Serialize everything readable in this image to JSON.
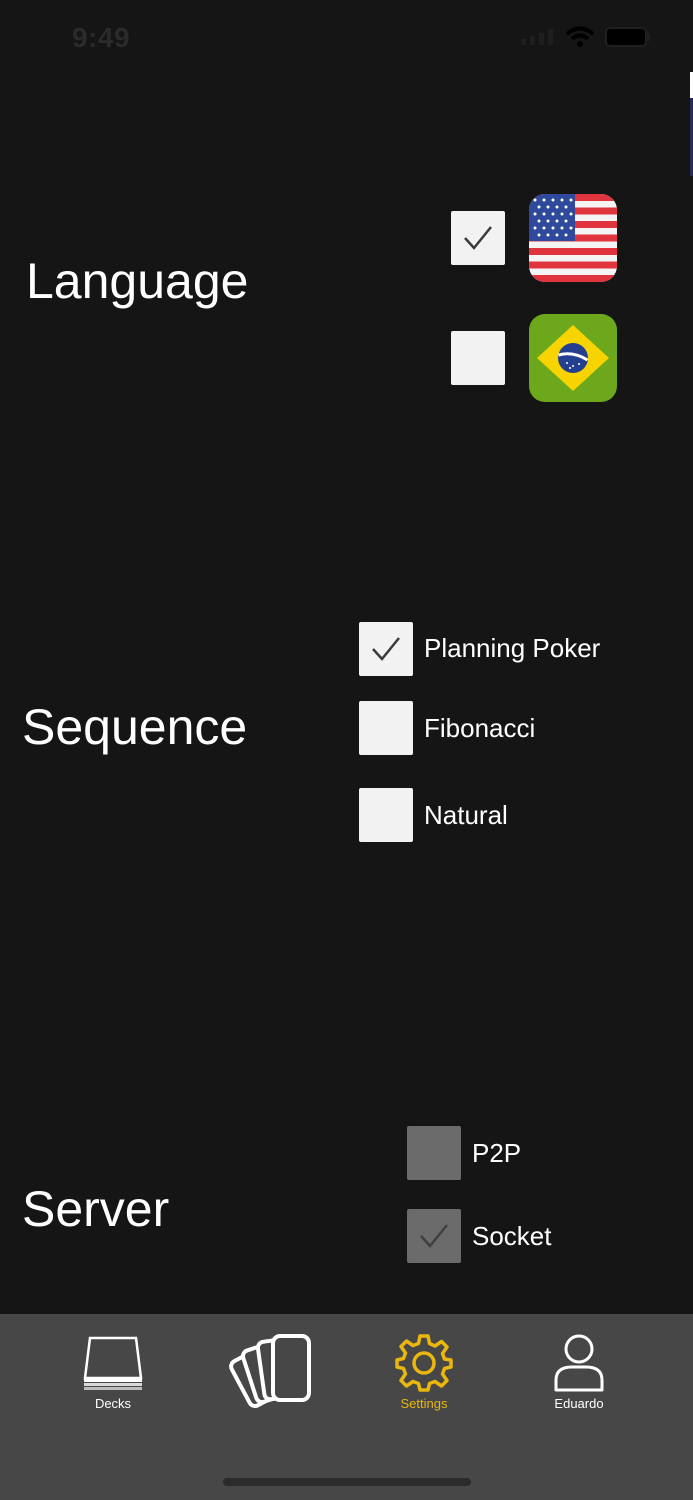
{
  "status_bar": {
    "time": "9:49"
  },
  "language": {
    "title": "Language",
    "options": [
      {
        "name": "English (US)",
        "flag": "us-flag-icon",
        "checked": true
      },
      {
        "name": "Portuguese (BR)",
        "flag": "brazil-flag-icon",
        "checked": false
      }
    ]
  },
  "sequence": {
    "title": "Sequence",
    "options": [
      {
        "label": "Planning Poker",
        "checked": true
      },
      {
        "label": "Fibonacci",
        "checked": false
      },
      {
        "label": "Natural",
        "checked": false
      }
    ]
  },
  "server": {
    "title": "Server",
    "options": [
      {
        "label": "P2P",
        "checked": false
      },
      {
        "label": "Socket",
        "checked": true
      }
    ]
  },
  "tab_bar": {
    "tabs": [
      {
        "label": "Decks",
        "icon": "deck-icon",
        "active": false
      },
      {
        "label": "",
        "icon": "cards-icon",
        "active": false
      },
      {
        "label": "Settings",
        "icon": "gear-icon",
        "active": true
      },
      {
        "label": "Eduardo",
        "icon": "user-icon",
        "active": false
      }
    ]
  },
  "colors": {
    "background": "#151515",
    "tab_bar": "#474747",
    "accent": "#e9b70d",
    "checkbox": "#f2f2f2",
    "checkbox_disabled": "#6b6b6b"
  }
}
